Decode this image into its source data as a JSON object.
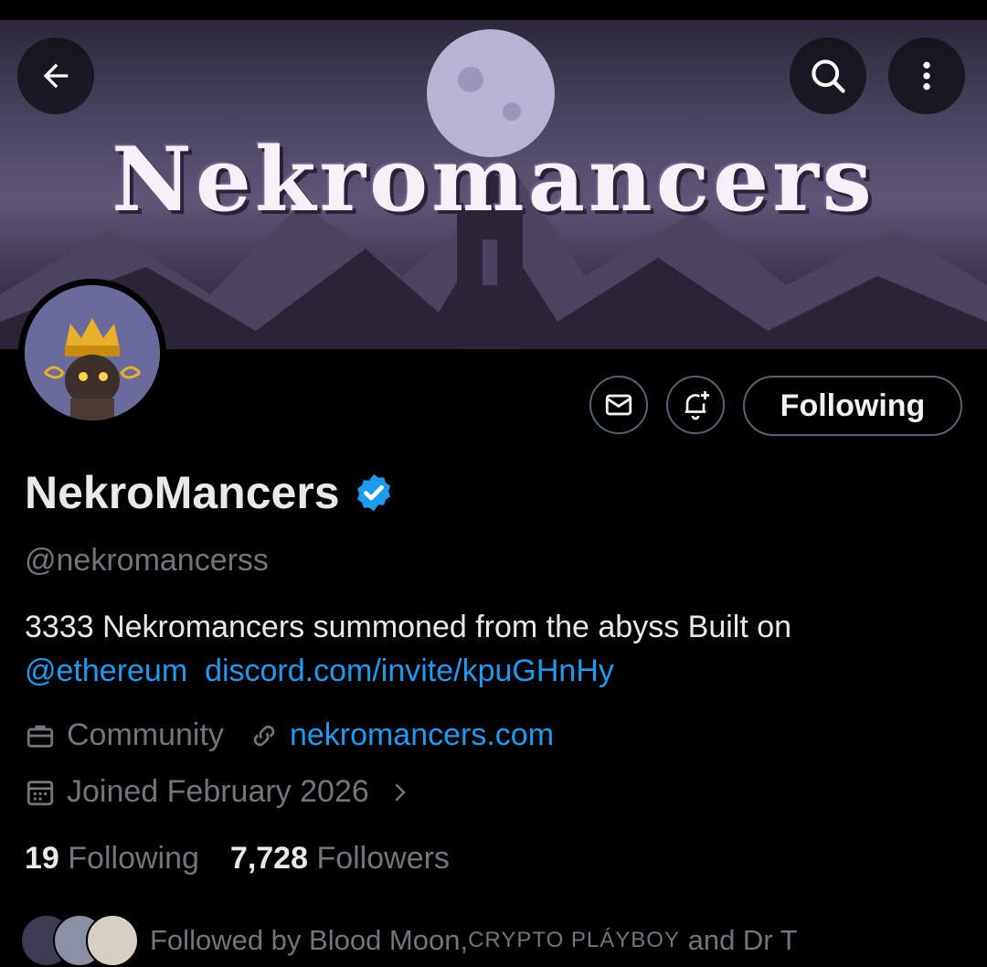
{
  "banner": {
    "title": "Nekromancers"
  },
  "header": {
    "back_icon": "arrow-left-icon",
    "search_icon": "search-icon",
    "more_icon": "more-vertical-icon"
  },
  "actions": {
    "message_icon": "envelope-icon",
    "notify_icon": "bell-plus-icon",
    "follow_label": "Following"
  },
  "profile": {
    "display_name": "NekroMancers",
    "verified_icon": "verified-badge-icon",
    "verified_color": "#1d9bf0",
    "handle": "@nekromancerss",
    "bio_text": "3333 Nekromancers summoned from the abyss  Built on",
    "bio_mention": "@ethereum",
    "bio_link": "discord.com/invite/kpuGHnHy",
    "category": "Community",
    "website": "nekromancers.com",
    "joined": "Joined February 2026"
  },
  "stats": {
    "following_count": "19",
    "following_label": "Following",
    "followers_count": "7,728",
    "followers_label": "Followers"
  },
  "followed_by": {
    "prefix": "Followed by Blood Moon, ",
    "name2": "CRYPTO PLÁYBOY",
    "mid": " and ",
    "name3": "Dr T"
  },
  "colors": {
    "link": "#1d9bf0",
    "muted": "#71767b",
    "text": "#e7e9ea",
    "border": "#536471"
  }
}
